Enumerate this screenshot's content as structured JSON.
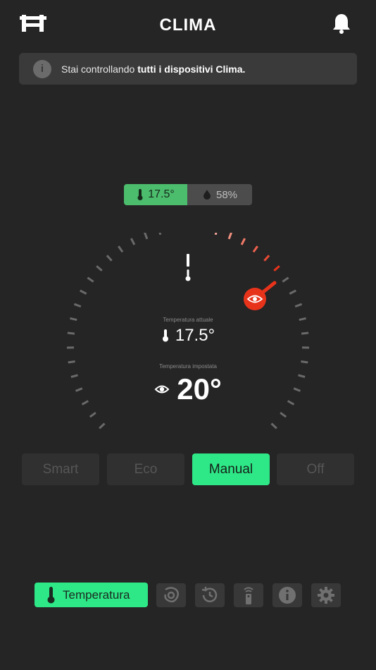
{
  "header": {
    "title": "CLIMA",
    "logo": "logo-icon",
    "bell": "bell-icon"
  },
  "banner": {
    "prefix": "Stai controllando ",
    "bold": "tutti i dispositivi Clima.",
    "icon": "info-icon"
  },
  "status": {
    "temperature": "17.5°",
    "humidity": "58%"
  },
  "gauge": {
    "current_label": "Temperatura attuale",
    "current_value": "17.5°",
    "set_label": "Temperatura impostata",
    "set_value": "20°"
  },
  "modes": [
    "Smart",
    "Eco",
    "Manual",
    "Off"
  ],
  "active_mode": "Manual",
  "tabs": {
    "temperature_label": "Temperatura"
  },
  "colors": {
    "accent": "#2ee887",
    "status_green": "#4cbc6d",
    "setpoint_red": "#e8331b",
    "background": "#252525"
  }
}
